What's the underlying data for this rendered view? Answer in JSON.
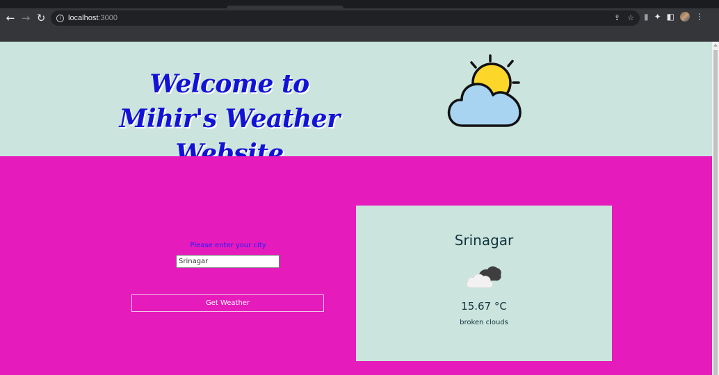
{
  "browser": {
    "url_host": "localhost",
    "url_port": ":3000"
  },
  "header": {
    "title": "Welcome to Mihir's Weather Website"
  },
  "form": {
    "label": "Please enter your city",
    "city_value": "Srinagar",
    "button_label": "Get Weather"
  },
  "weather_card": {
    "city": "Srinagar",
    "temperature": "15.67 °C",
    "description": "broken clouds",
    "icon": "broken-clouds-icon"
  },
  "colors": {
    "header_bg": "#cbe4dd",
    "main_bg": "#e61bbb",
    "title": "#1313d6",
    "label": "#1d1dff"
  }
}
